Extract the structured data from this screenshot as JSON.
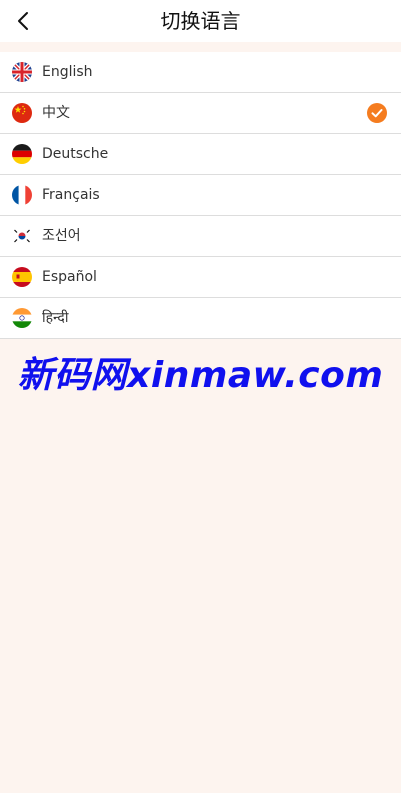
{
  "header": {
    "title": "切换语言",
    "back_icon": "chevron-left-icon"
  },
  "languages": [
    {
      "label": "English",
      "flag": "uk-flag-icon",
      "selected": false
    },
    {
      "label": "中文",
      "flag": "china-flag-icon",
      "selected": true
    },
    {
      "label": "Deutsche",
      "flag": "germany-flag-icon",
      "selected": false
    },
    {
      "label": "Français",
      "flag": "france-flag-icon",
      "selected": false
    },
    {
      "label": "조선어",
      "flag": "korea-flag-icon",
      "selected": false
    },
    {
      "label": "Español",
      "flag": "spain-flag-icon",
      "selected": false
    },
    {
      "label": "हिन्दी",
      "flag": "india-flag-icon",
      "selected": false
    }
  ],
  "selected_icon": "check-circle-icon",
  "watermark": "新码网xinmaw.com",
  "colors": {
    "background": "#fdf4ef",
    "accent": "#f57c1f",
    "watermark": "#1010ee"
  }
}
